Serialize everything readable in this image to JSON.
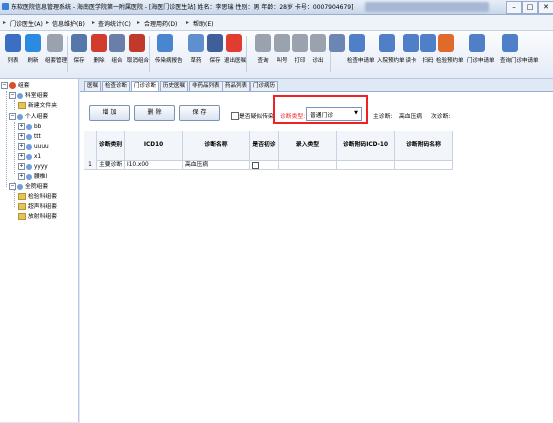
{
  "titlebar": {
    "text": "东软医院信息管理系统 - 海南医学院第一附属医院 - [海医门诊医生站] 姓名：李思瑞 性别：男 年龄：28岁 卡号：0007904679]",
    "min": "–",
    "max": "□",
    "close": "✕"
  },
  "menu": {
    "items": [
      "门诊医生(A)",
      "信息维护(B)",
      "查询统计(C)",
      "合理用药(D)",
      "帮助(E)"
    ]
  },
  "toolbar": {
    "buttons": [
      {
        "label": "列表",
        "icon": "list-icon",
        "color": "#3a6fc4"
      },
      {
        "label": "刷新",
        "icon": "refresh-icon",
        "color": "#2b8be0"
      },
      {
        "label": "组套管理",
        "icon": "group-icon",
        "color": "#9aa3ad"
      },
      {
        "label": "保存",
        "icon": "save-icon",
        "color": "#5577aa"
      },
      {
        "label": "删除",
        "icon": "delete-icon",
        "color": "#d23c2c"
      },
      {
        "label": "组合",
        "icon": "combine-icon",
        "color": "#6a7fa8"
      },
      {
        "label": "取消组合",
        "icon": "uncombine-icon",
        "color": "#c0392b"
      },
      {
        "label": "传染病报告",
        "icon": "report-icon",
        "color": "#4a86d0"
      },
      {
        "label": "草药",
        "icon": "herb-icon",
        "color": "#5f8fcf"
      },
      {
        "label": "保存",
        "icon": "disk-icon",
        "color": "#3e5f99"
      },
      {
        "label": "退出医嘱",
        "icon": "exit-icon",
        "color": "#e23b2f"
      },
      {
        "label": "查询",
        "icon": "search-icon",
        "color": "#9aa3ad"
      },
      {
        "label": "叫号",
        "icon": "call-icon",
        "color": "#9aa3ad"
      },
      {
        "label": "打印",
        "icon": "print-icon",
        "color": "#9aa3ad"
      },
      {
        "label": "诊出",
        "icon": "out-icon",
        "color": "#9aa3ad"
      },
      {
        "label": "",
        "icon": "magnifier-icon",
        "color": "#6b86b3"
      },
      {
        "label": "检查申请单",
        "icon": "check-form-icon",
        "color": "#4f7fc7"
      },
      {
        "label": "入院预约单",
        "icon": "admit-form-icon",
        "color": "#4f7fc7"
      },
      {
        "label": "读卡",
        "icon": "card-icon",
        "color": "#4f7fc7"
      },
      {
        "label": "扫码",
        "icon": "scan-icon",
        "color": "#4f7fc7"
      },
      {
        "label": "检验预约单",
        "icon": "lab-form-icon",
        "color": "#e06a2c"
      },
      {
        "label": "门诊申请单",
        "icon": "clinic-form-icon",
        "color": "#4f7fc7"
      },
      {
        "label": "查询门诊申请单",
        "icon": "query-form-icon",
        "color": "#4f7fc7"
      }
    ]
  },
  "tree": {
    "root": "组套",
    "dept": "科室组套",
    "dept_child": "新建文件夹",
    "personal": "个人组套",
    "personal_items": [
      "bb",
      "ttt",
      "uuuu",
      "x1",
      "yyyy",
      "腰椎l"
    ],
    "all": "全院组套",
    "all_items": [
      "检验科组套",
      "超声科组套",
      "放射科组套"
    ]
  },
  "tabs": [
    "医嘱",
    "检查诊断",
    "门诊诊断",
    "历史医嘱",
    "非药品列表",
    "药品列表",
    "门诊病历"
  ],
  "toolbar2": {
    "add": "增 加",
    "delete": "删 除",
    "save": "保 存",
    "checkbox_label": "是否疑似传染",
    "diag_type_label": "诊断类型:",
    "diag_type_value": "普通门诊",
    "main_diag_label": "主诊断:",
    "main_diag_value": "高血压病",
    "secondary_diag_label": "次诊断:"
  },
  "grid": {
    "headers": [
      "诊断类别",
      "ICD10",
      "诊断名称",
      "是否初诊",
      "录入类型",
      "诊断附码ICD-10",
      "诊断附码名称"
    ],
    "rows": [
      {
        "num": "1",
        "category": "主要诊断",
        "icd10": "I10.x00",
        "name": "高血压病",
        "first_visit": false,
        "entry_type": "",
        "attach_code": "",
        "attach_name": ""
      }
    ]
  }
}
